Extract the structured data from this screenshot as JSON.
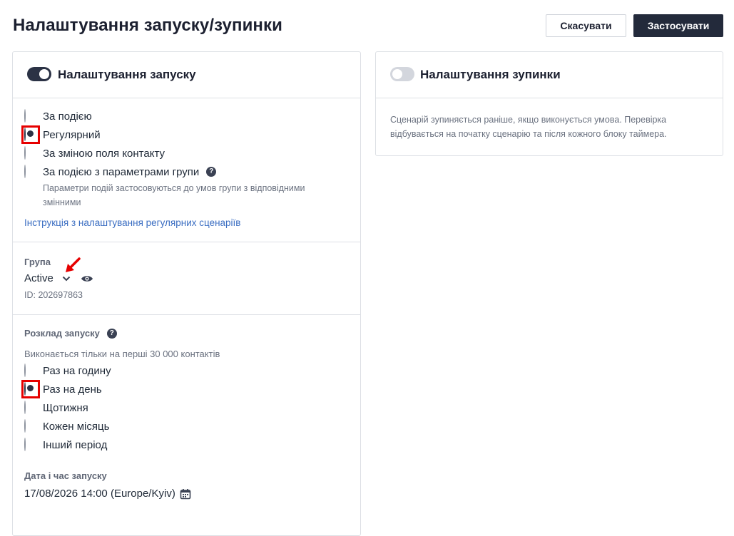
{
  "header": {
    "title": "Налаштування запуску/зупинки",
    "cancel_label": "Скасувати",
    "apply_label": "Застосувати"
  },
  "launch": {
    "title": "Налаштування запуску",
    "toggle_on": true,
    "trigger_options": [
      {
        "label": "За подією",
        "checked": false
      },
      {
        "label": "Регулярний",
        "checked": true
      },
      {
        "label": "За зміною поля контакту",
        "checked": false
      },
      {
        "label": "За подією з параметрами групи",
        "checked": false
      }
    ],
    "group_params_hint": "Параметри подій застосовуються до умов групи з відповідними змінними",
    "instruction_link": "Інструкція з налаштування регулярних сценаріїв",
    "group": {
      "label": "Група",
      "value": "Active",
      "id_text": "ID: 202697863"
    },
    "schedule": {
      "label": "Розклад запуску",
      "hint": "Виконається тільки на перші 30 000 контактів",
      "options": [
        {
          "label": "Раз на годину",
          "checked": false
        },
        {
          "label": "Раз на день",
          "checked": true
        },
        {
          "label": "Щотижня",
          "checked": false
        },
        {
          "label": "Кожен місяць",
          "checked": false
        },
        {
          "label": "Інший період",
          "checked": false
        }
      ]
    },
    "datetime": {
      "label": "Дата і час запуску",
      "value": "17/08/2026 14:00 (Europe/Kyiv)"
    }
  },
  "stop": {
    "title": "Налаштування зупинки",
    "toggle_on": false,
    "description": "Сценарій зупиняється раніше, якщо виконується умова. Перевірка відбувається на початку сценарію та після кожного блоку таймера."
  },
  "colors": {
    "primary": "#232a3b",
    "link": "#3b6ec2",
    "annotation": "#e60000"
  }
}
